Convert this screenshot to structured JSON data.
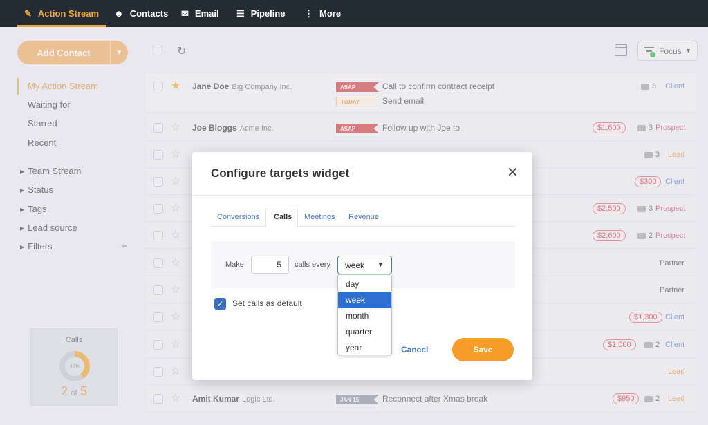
{
  "nav": {
    "items": [
      {
        "label": "Action Stream",
        "icon": "action-stream-icon"
      },
      {
        "label": "Contacts",
        "icon": "contacts-icon"
      },
      {
        "label": "Email",
        "icon": "email-icon"
      },
      {
        "label": "Pipeline",
        "icon": "pipeline-icon"
      },
      {
        "label": "More",
        "icon": "more-icon"
      }
    ]
  },
  "sidebar": {
    "add_contact": "Add Contact",
    "items": [
      "My Action Stream",
      "Waiting for",
      "Starred",
      "Recent"
    ],
    "tree": [
      "Team Stream",
      "Status",
      "Tags",
      "Lead source",
      "Filters"
    ],
    "widget": {
      "title": "Calls",
      "percent": "40%",
      "current": "2",
      "of": "of",
      "target": "5"
    }
  },
  "toolbar": {
    "focus_label": "Focus"
  },
  "rows": [
    {
      "name": "Jane Doe",
      "company": "Big Company Inc.",
      "starred": true,
      "tasks": [
        {
          "tag": "ASAP",
          "text": "Call to confirm contract receipt"
        },
        {
          "tag": "TODAY",
          "text": "Send email"
        }
      ],
      "count": "3",
      "stage": "Client"
    },
    {
      "name": "Joe Bloggs",
      "company": "Acme Inc.",
      "tag": "ASAP",
      "task": "Follow up with Joe to",
      "amount": "$1,600",
      "count": "3",
      "stage": "Prospect"
    },
    {
      "count": "3",
      "stage": "Lead"
    },
    {
      "amount": "$300",
      "stage": "Client"
    },
    {
      "amount": "$2,500",
      "count": "3",
      "stage": "Prospect"
    },
    {
      "amount": "$2,600",
      "count": "2",
      "stage": "Prospect"
    },
    {
      "stage": "Partner"
    },
    {
      "stage": "Partner"
    },
    {
      "amount": "$1,300",
      "stage": "Client"
    },
    {
      "amount": "$1,000",
      "count": "2",
      "stage": "Client"
    },
    {
      "stage": "Lead"
    },
    {
      "name": "Amit Kumar",
      "company": "Logic Ltd.",
      "tag": "JAN 15",
      "task": "Reconnect after Xmas break",
      "amount": "$950",
      "count": "2",
      "stage": "Lead"
    }
  ],
  "modal": {
    "title": "Configure targets widget",
    "tabs": [
      "Conversions",
      "Calls",
      "Meetings",
      "Revenue"
    ],
    "active_tab": "Calls",
    "make_label": "Make",
    "calls_value": "5",
    "every_label": "calls every",
    "period_selected": "week",
    "period_options": [
      "day",
      "week",
      "month",
      "quarter",
      "year"
    ],
    "default_label": "Set calls as default",
    "default_checked": true,
    "cancel_label": "Cancel",
    "save_label": "Save"
  },
  "colors": {
    "accent": "#f0a93a",
    "nav_bg": "#232b35",
    "save": "#f89c2a",
    "link": "#3d6fbf",
    "asap": "#d44a4a"
  }
}
